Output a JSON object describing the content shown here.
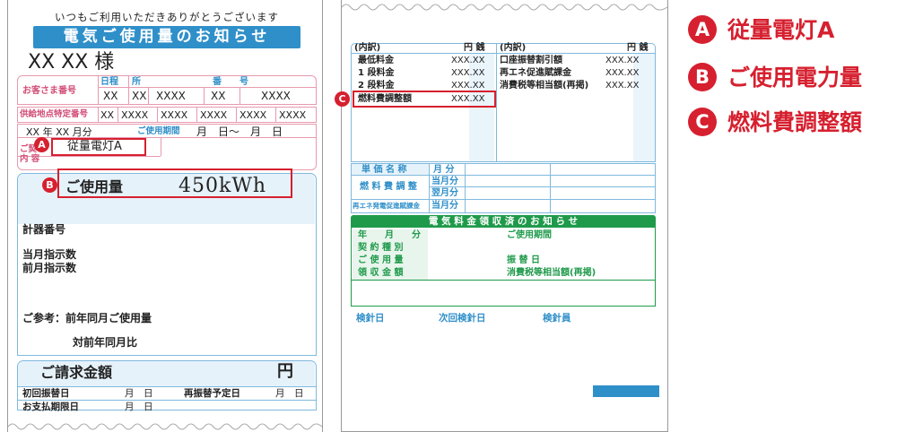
{
  "bill": {
    "greeting": "いつもご利用いただきありがとうございます",
    "banner": "電気ご使用量のお知らせ",
    "customer_name": "XX XX 様",
    "customer_number_label": "お客さま番号",
    "col_date": "日程",
    "col_place": "所",
    "col_number": "番　　号",
    "customer_number_cells": [
      "XX",
      "XX",
      "XXXX",
      "XX",
      "XXXX"
    ],
    "supply_label": "供給地点特定番号",
    "supply_cells": [
      "XX",
      "XXXX",
      "XXXX",
      "XXXX",
      "XXXX",
      "XXXX"
    ],
    "period_month": "XX 年 XX 月分",
    "period_label": "ご使用期間",
    "period_value": "月　日～　月　日",
    "contract_label_1": "ご契",
    "contract_label_2": "内 容",
    "contract_value": "従量電灯A",
    "usage_label": "ご使用量",
    "usage_value": "450kWh",
    "meter_no": "計器番号",
    "current_reading": "当月指示数",
    "previous_reading": "前月指示数",
    "reference_label": "ご参考：前年同月ご使用量",
    "compare_label": "対前年同月比",
    "billing_label": "ご請求金額",
    "yen": "円",
    "first_debit": "初回振替日",
    "month_day_1": "月　日",
    "redebit": "再振替予定日",
    "month_day_2": "月　日",
    "deadline": "お支払期限日",
    "month_day_3": "月　日"
  },
  "receipt": {
    "breakdown_label": "(内訳)",
    "yen_sen_1": "円 銭",
    "breakdown_label_2": "(内訳)",
    "yen_sen_2": "円 銭",
    "rows_left": [
      {
        "label": "最低料金",
        "value": "XXX.XX"
      },
      {
        "label": "1 段料金",
        "value": "XXX.XX"
      },
      {
        "label": "2 段料金",
        "value": "XXX.XX"
      },
      {
        "label": "燃料費調整額",
        "value": "XXX.XX"
      }
    ],
    "rows_right": [
      {
        "label": "口座振替割引額",
        "value": "XXX.XX"
      },
      {
        "label": "再エネ促進賦課金",
        "value": "XXX.XX"
      },
      {
        "label": "消費税等相当額(再掲)",
        "value": "XXX.XX"
      }
    ],
    "unit_price_label": "単 価 名 称",
    "month_col": "月 分",
    "fuel_adjust_label": "燃 料 費 調 整",
    "this_month": "当月分",
    "next_month": "翌月分",
    "renewable_label": "再エネ発電促進賦課金",
    "this_month_2": "当月分",
    "payment_banner": "電 気 料 金 領 収 済 の お 知 ら せ",
    "year_month": "年　　月　　分",
    "usage_period": "ご使用期間",
    "contract_type": "契 約 種 別",
    "usage_amount": "ご 使 用 量",
    "debit_date": "振 替 日",
    "received_amount": "領 収 金 額",
    "tax_amount": "消費税等相当額(再掲)",
    "inspection_date": "検針日",
    "next_inspection": "次回検針日",
    "inspector": "検針員"
  },
  "legend": [
    {
      "badge": "A",
      "text": "従量電灯A"
    },
    {
      "badge": "B",
      "text": "ご使用電力量"
    },
    {
      "badge": "C",
      "text": "燃料費調整額"
    }
  ],
  "colors": {
    "accent_red": "#d6202f",
    "bill_blue": "#2f8fc9",
    "pink": "#e79aae",
    "green": "#1f9a4a"
  }
}
